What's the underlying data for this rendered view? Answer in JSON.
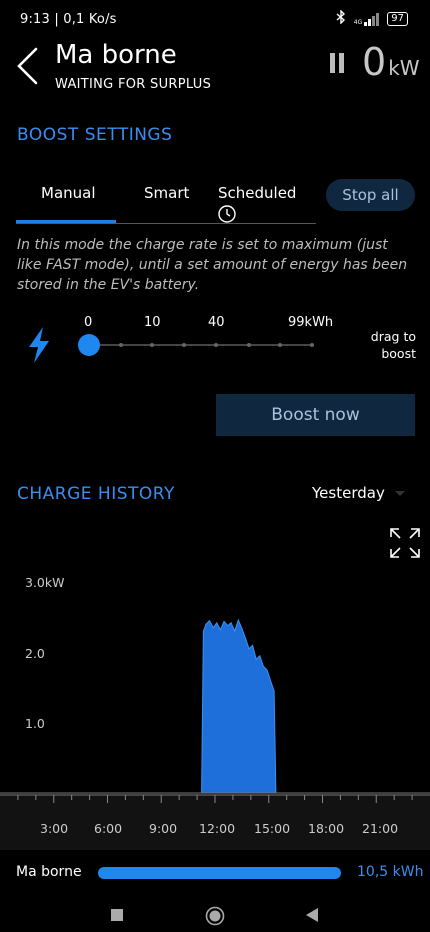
{
  "status_bar": {
    "time": "9:13",
    "net_speed": "0,1 Ko/s",
    "net_type": "4G",
    "battery": "97"
  },
  "header": {
    "title": "Ma borne",
    "subtitle": "WAITING FOR SURPLUS",
    "power_value": "0",
    "power_unit": "kW"
  },
  "boost": {
    "section_title": "BOOST SETTINGS",
    "tabs": [
      {
        "label": "Manual",
        "active": true
      },
      {
        "label": "Smart",
        "active": false
      },
      {
        "label": "Scheduled",
        "active": false
      }
    ],
    "stop_all_label": "Stop all",
    "description": "In this mode the charge rate is set to maximum (just like FAST mode), until a set amount of energy has been stored in the EV's battery.",
    "slider_labels": [
      "0",
      "10",
      "40",
      "99kWh"
    ],
    "slider_value": 0,
    "drag_hint_line1": "drag to",
    "drag_hint_line2": "boost",
    "boost_now_label": "Boost now"
  },
  "history": {
    "section_title": "CHARGE HISTORY",
    "period_selected": "Yesterday"
  },
  "chart_data": {
    "type": "area",
    "ylabel": "",
    "y_ticks": [
      "3.0kW",
      "2.0",
      "1.0"
    ],
    "ylim": [
      0,
      3.0
    ],
    "x_ticks": [
      "3:00",
      "6:00",
      "9:00",
      "12:00",
      "15:00",
      "18:00",
      "21:00"
    ],
    "xlim": [
      0,
      24
    ],
    "series": [
      {
        "color": "#1e6fd9",
        "x": [
          11.25,
          11.35,
          11.5,
          11.7,
          11.9,
          12.1,
          12.3,
          12.5,
          12.7,
          12.9,
          13.1,
          13.3,
          13.5,
          13.7,
          13.9,
          14.1,
          14.3,
          14.5,
          14.7,
          14.9,
          15.1,
          15.3,
          15.4
        ],
        "y": [
          0,
          2.3,
          2.4,
          2.45,
          2.35,
          2.42,
          2.32,
          2.44,
          2.38,
          2.42,
          2.3,
          2.46,
          2.34,
          2.2,
          2.05,
          2.1,
          1.9,
          1.95,
          1.8,
          1.75,
          1.6,
          1.45,
          0
        ]
      }
    ]
  },
  "legend": {
    "name": "Ma borne",
    "value": "10,5 kWh"
  }
}
